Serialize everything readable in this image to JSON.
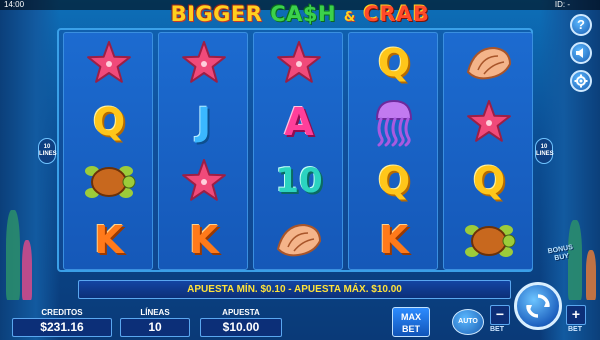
{
  "status_bar": {
    "time": "14:00",
    "id_label": "ID: -"
  },
  "logo": {
    "word1": "BIGGER",
    "word2": "CA$H",
    "amp": "&",
    "word3": "CRAB"
  },
  "side_buttons": [
    "?",
    "sound",
    "settings"
  ],
  "lines_badge": {
    "value": "10",
    "label": "LINES"
  },
  "reels": [
    [
      "starfish",
      "Q",
      "turtle",
      "K"
    ],
    [
      "starfish",
      "J",
      "starfish",
      "K"
    ],
    [
      "starfish",
      "A",
      "10",
      "shell"
    ],
    [
      "Q",
      "jellyfish",
      "Q",
      "K"
    ],
    [
      "shell",
      "starfish",
      "Q",
      "turtle"
    ]
  ],
  "bonus_buy": {
    "line1": "BONUS",
    "line2": "BUY"
  },
  "info_bar": {
    "text": "APUESTA MÍN. $0.10 - APUESTA MÁX. $10.00"
  },
  "stats": {
    "credits": {
      "label": "CREDITOS",
      "value": "$231.16"
    },
    "lines": {
      "label": "LÍNEAS",
      "value": "10"
    },
    "bet": {
      "label": "APUESTA",
      "value": "$10.00"
    }
  },
  "controls": {
    "max_bet_line1": "MAX",
    "max_bet_line2": "BET",
    "auto": "AUTO",
    "minus": "−",
    "plus": "+",
    "bet_label_left": "BET",
    "bet_label_right": "BET"
  },
  "colors": {
    "background": "#0b4f95",
    "reel": "#1c6bd0",
    "info_text": "#ffe23a"
  }
}
